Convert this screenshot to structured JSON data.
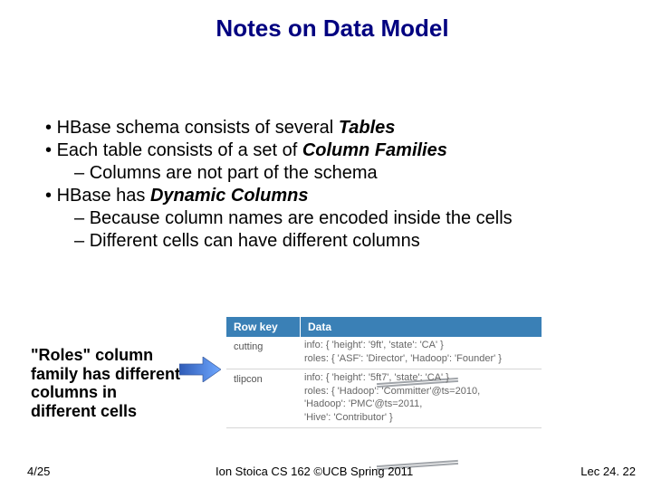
{
  "title": "Notes on Data Model",
  "bullets": {
    "b1_a_pre": "HBase schema consists of several ",
    "b1_a_em": "Tables",
    "b1_b_pre": "Each table consists of a set of ",
    "b1_b_em": "Column Families",
    "b2_a": "Columns are not part of the schema",
    "b1_c_pre": "HBase has ",
    "b1_c_em": "Dynamic Columns",
    "b2_b": "Because column names are encoded inside the cells",
    "b2_c": "Different cells can have different columns"
  },
  "callout": "\"Roles\" column family has different columns in different cells",
  "table": {
    "headers": {
      "c1": "Row key",
      "c2": "Data"
    },
    "rows": [
      {
        "key": "cutting",
        "lines": [
          "info: { 'height': '9ft', 'state': 'CA' }",
          "roles: { 'ASF': 'Director', 'Hadoop': 'Founder' }"
        ]
      },
      {
        "key": "tlipcon",
        "lines": [
          "info: { 'height': '5ft7', 'state': 'CA' }",
          "roles: { 'Hadoop': 'Committer'@ts=2010,",
          "             'Hadoop': 'PMC'@ts=2011,",
          "             'Hive': 'Contributor' }"
        ]
      }
    ]
  },
  "footer": {
    "left": "4/25",
    "center": "Ion Stoica CS 162 ©UCB Spring 2011",
    "right": "Lec 24. 22"
  }
}
